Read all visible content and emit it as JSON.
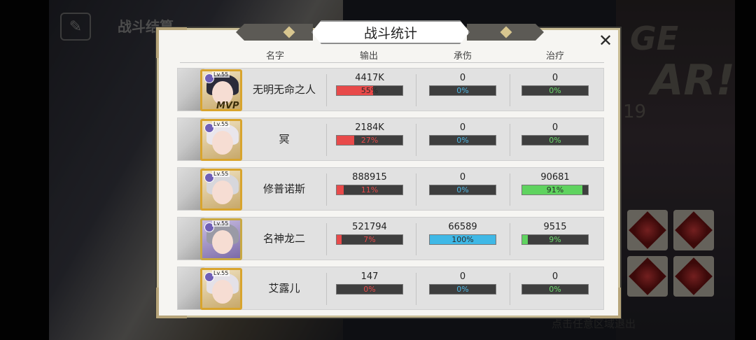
{
  "background": {
    "top_title": "战斗结算",
    "deco_text_1": "GE",
    "deco_text_2": "AR!",
    "deco_text_3": "19",
    "exit_hint": "点击任意区域退出"
  },
  "panel": {
    "title": "战斗统计",
    "columns": {
      "name": "名字",
      "damage": "输出",
      "taken": "承伤",
      "heal": "治疗"
    },
    "rows": [
      {
        "level": "Lv.55",
        "name": "无明无命之人",
        "mvp": "MVP",
        "damage": {
          "value": "4417K",
          "pct_label": "55%",
          "pct": 0.55
        },
        "taken": {
          "value": "0",
          "pct_label": "0%",
          "pct": 0
        },
        "heal": {
          "value": "0",
          "pct_label": "0%",
          "pct": 0
        }
      },
      {
        "level": "Lv.55",
        "name": "冥",
        "mvp": "",
        "damage": {
          "value": "2184K",
          "pct_label": "27%",
          "pct": 0.27
        },
        "taken": {
          "value": "0",
          "pct_label": "0%",
          "pct": 0
        },
        "heal": {
          "value": "0",
          "pct_label": "0%",
          "pct": 0
        }
      },
      {
        "level": "Lv.55",
        "name": "修普诺斯",
        "mvp": "",
        "damage": {
          "value": "888915",
          "pct_label": "11%",
          "pct": 0.11
        },
        "taken": {
          "value": "0",
          "pct_label": "0%",
          "pct": 0
        },
        "heal": {
          "value": "90681",
          "pct_label": "91%",
          "pct": 0.91
        }
      },
      {
        "level": "Lv.55",
        "name": "名神龙二",
        "mvp": "",
        "damage": {
          "value": "521794",
          "pct_label": "7%",
          "pct": 0.07
        },
        "taken": {
          "value": "66589",
          "pct_label": "100%",
          "pct": 1.0
        },
        "heal": {
          "value": "9515",
          "pct_label": "9%",
          "pct": 0.09
        }
      },
      {
        "level": "Lv.55",
        "name": "艾露儿",
        "mvp": "",
        "damage": {
          "value": "147",
          "pct_label": "0%",
          "pct": 0
        },
        "taken": {
          "value": "0",
          "pct_label": "0%",
          "pct": 0
        },
        "heal": {
          "value": "0",
          "pct_label": "0%",
          "pct": 0
        }
      }
    ]
  },
  "close_icon": "close-icon",
  "colors": {
    "damage": "#e84a4a",
    "taken": "#3fb8e6",
    "heal": "#5fd35f",
    "frame_gold": "#c9bd95"
  }
}
